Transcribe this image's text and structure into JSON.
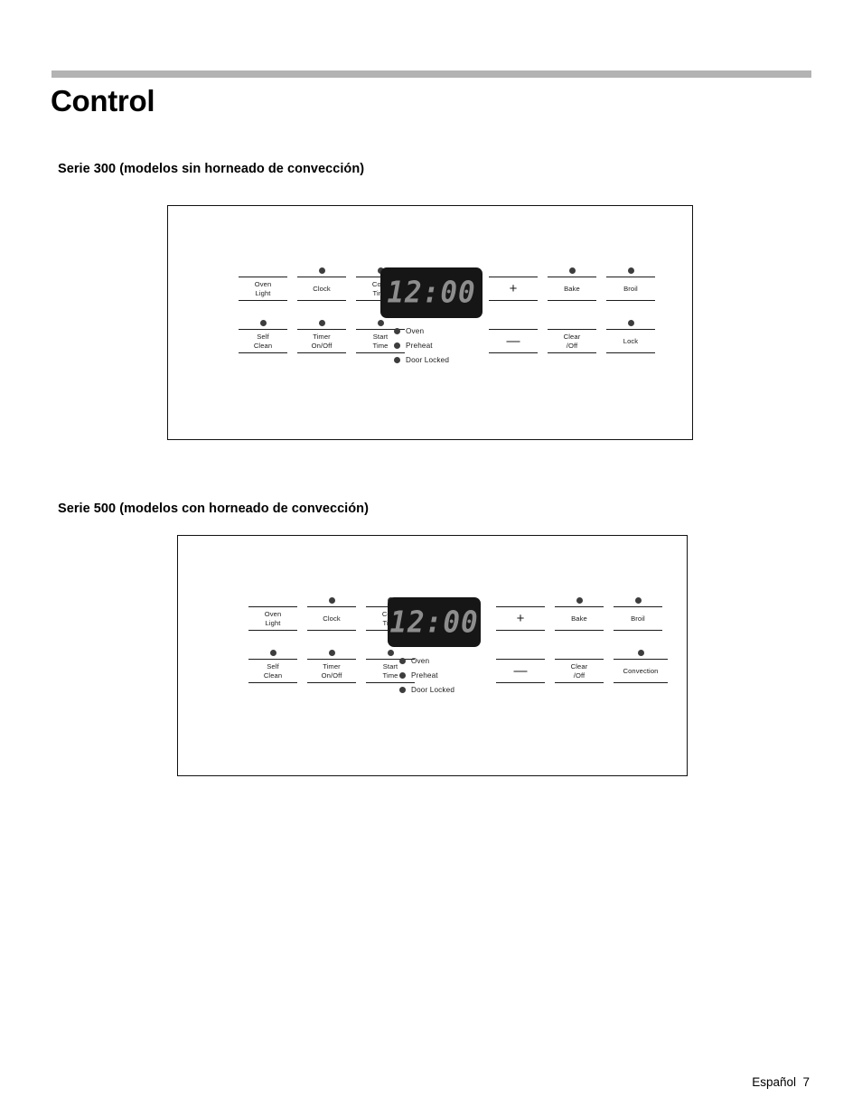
{
  "page": {
    "title": "Control",
    "footer": "Español  7"
  },
  "sections": [
    {
      "id": "serie-300",
      "heading": "Serie 300 (modelos sin horneado de convección)"
    },
    {
      "id": "serie-500",
      "heading": "Serie 500 (modelos con horneado de convección)"
    }
  ],
  "panel_300": {
    "display": {
      "value": "12:00"
    },
    "left_keys_row1": [
      {
        "lines": [
          "Oven",
          "Light"
        ],
        "indicator": false
      },
      {
        "lines": [
          "Clock"
        ],
        "indicator": true
      },
      {
        "lines": [
          "Cook",
          "Time"
        ],
        "indicator": true
      }
    ],
    "left_keys_row2": [
      {
        "lines": [
          "Self",
          "Clean"
        ],
        "indicator": true
      },
      {
        "lines": [
          "Timer",
          "On/Off"
        ],
        "indicator": true
      },
      {
        "lines": [
          "Start",
          "Time"
        ],
        "indicator": true
      }
    ],
    "right_keys_row1": [
      {
        "lines": [
          "+"
        ],
        "indicator": false,
        "symbol": true
      },
      {
        "lines": [
          "Bake"
        ],
        "indicator": true
      },
      {
        "lines": [
          "Broil"
        ],
        "indicator": true
      }
    ],
    "right_keys_row2": [
      {
        "lines": [
          "—"
        ],
        "indicator": false,
        "symbol": true
      },
      {
        "lines": [
          "Clear",
          "/Off"
        ],
        "indicator": false
      },
      {
        "lines": [
          "Lock"
        ],
        "indicator": true
      }
    ],
    "lamps": [
      {
        "label": "Oven"
      },
      {
        "label": "Preheat"
      },
      {
        "label": "Door Locked"
      }
    ]
  },
  "panel_500": {
    "display": {
      "value": "12:00"
    },
    "left_keys_row1": [
      {
        "lines": [
          "Oven",
          "Light"
        ],
        "indicator": false
      },
      {
        "lines": [
          "Clock"
        ],
        "indicator": true
      },
      {
        "lines": [
          "Cook",
          "Time"
        ],
        "indicator": true
      }
    ],
    "left_keys_row2": [
      {
        "lines": [
          "Self",
          "Clean"
        ],
        "indicator": true
      },
      {
        "lines": [
          "Timer",
          "On/Off"
        ],
        "indicator": true
      },
      {
        "lines": [
          "Start",
          "Time"
        ],
        "indicator": true
      }
    ],
    "right_keys_row1": [
      {
        "lines": [
          "+"
        ],
        "indicator": false,
        "symbol": true
      },
      {
        "lines": [
          "Bake"
        ],
        "indicator": true
      },
      {
        "lines": [
          "Broil"
        ],
        "indicator": true
      }
    ],
    "right_keys_row2": [
      {
        "lines": [
          "—"
        ],
        "indicator": false,
        "symbol": true
      },
      {
        "lines": [
          "Clear",
          "/Off"
        ],
        "indicator": false
      },
      {
        "lines": [
          "Convection"
        ],
        "indicator": true
      }
    ],
    "lamps": [
      {
        "label": "Oven"
      },
      {
        "label": "Preheat"
      },
      {
        "label": "Door Locked"
      }
    ]
  },
  "colors": {
    "rule": "#b3b3b3",
    "ink": "#1b1b1b",
    "display_bg": "#161616",
    "display_fg": "#8d8d8d",
    "indicator": "#3d3d3d"
  }
}
